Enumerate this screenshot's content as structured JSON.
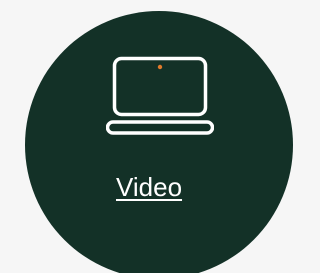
{
  "card": {
    "background_color": "#133127",
    "page_background": "#f6f6f6",
    "icon": "laptop-icon",
    "icon_color": "#ffffff",
    "webcam_dot_color": "#e07a2b",
    "link_label": "Video"
  }
}
